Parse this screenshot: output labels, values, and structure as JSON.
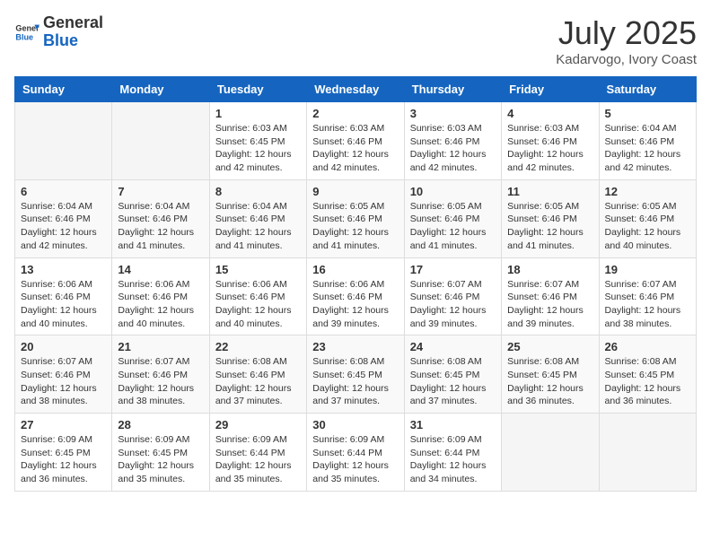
{
  "header": {
    "logo_general": "General",
    "logo_blue": "Blue",
    "month_title": "July 2025",
    "location": "Kadarvogo, Ivory Coast"
  },
  "days_of_week": [
    "Sunday",
    "Monday",
    "Tuesday",
    "Wednesday",
    "Thursday",
    "Friday",
    "Saturday"
  ],
  "weeks": [
    [
      {
        "day": "",
        "info": ""
      },
      {
        "day": "",
        "info": ""
      },
      {
        "day": "1",
        "info": "Sunrise: 6:03 AM\nSunset: 6:45 PM\nDaylight: 12 hours and 42 minutes."
      },
      {
        "day": "2",
        "info": "Sunrise: 6:03 AM\nSunset: 6:46 PM\nDaylight: 12 hours and 42 minutes."
      },
      {
        "day": "3",
        "info": "Sunrise: 6:03 AM\nSunset: 6:46 PM\nDaylight: 12 hours and 42 minutes."
      },
      {
        "day": "4",
        "info": "Sunrise: 6:03 AM\nSunset: 6:46 PM\nDaylight: 12 hours and 42 minutes."
      },
      {
        "day": "5",
        "info": "Sunrise: 6:04 AM\nSunset: 6:46 PM\nDaylight: 12 hours and 42 minutes."
      }
    ],
    [
      {
        "day": "6",
        "info": "Sunrise: 6:04 AM\nSunset: 6:46 PM\nDaylight: 12 hours and 42 minutes."
      },
      {
        "day": "7",
        "info": "Sunrise: 6:04 AM\nSunset: 6:46 PM\nDaylight: 12 hours and 41 minutes."
      },
      {
        "day": "8",
        "info": "Sunrise: 6:04 AM\nSunset: 6:46 PM\nDaylight: 12 hours and 41 minutes."
      },
      {
        "day": "9",
        "info": "Sunrise: 6:05 AM\nSunset: 6:46 PM\nDaylight: 12 hours and 41 minutes."
      },
      {
        "day": "10",
        "info": "Sunrise: 6:05 AM\nSunset: 6:46 PM\nDaylight: 12 hours and 41 minutes."
      },
      {
        "day": "11",
        "info": "Sunrise: 6:05 AM\nSunset: 6:46 PM\nDaylight: 12 hours and 41 minutes."
      },
      {
        "day": "12",
        "info": "Sunrise: 6:05 AM\nSunset: 6:46 PM\nDaylight: 12 hours and 40 minutes."
      }
    ],
    [
      {
        "day": "13",
        "info": "Sunrise: 6:06 AM\nSunset: 6:46 PM\nDaylight: 12 hours and 40 minutes."
      },
      {
        "day": "14",
        "info": "Sunrise: 6:06 AM\nSunset: 6:46 PM\nDaylight: 12 hours and 40 minutes."
      },
      {
        "day": "15",
        "info": "Sunrise: 6:06 AM\nSunset: 6:46 PM\nDaylight: 12 hours and 40 minutes."
      },
      {
        "day": "16",
        "info": "Sunrise: 6:06 AM\nSunset: 6:46 PM\nDaylight: 12 hours and 39 minutes."
      },
      {
        "day": "17",
        "info": "Sunrise: 6:07 AM\nSunset: 6:46 PM\nDaylight: 12 hours and 39 minutes."
      },
      {
        "day": "18",
        "info": "Sunrise: 6:07 AM\nSunset: 6:46 PM\nDaylight: 12 hours and 39 minutes."
      },
      {
        "day": "19",
        "info": "Sunrise: 6:07 AM\nSunset: 6:46 PM\nDaylight: 12 hours and 38 minutes."
      }
    ],
    [
      {
        "day": "20",
        "info": "Sunrise: 6:07 AM\nSunset: 6:46 PM\nDaylight: 12 hours and 38 minutes."
      },
      {
        "day": "21",
        "info": "Sunrise: 6:07 AM\nSunset: 6:46 PM\nDaylight: 12 hours and 38 minutes."
      },
      {
        "day": "22",
        "info": "Sunrise: 6:08 AM\nSunset: 6:46 PM\nDaylight: 12 hours and 37 minutes."
      },
      {
        "day": "23",
        "info": "Sunrise: 6:08 AM\nSunset: 6:45 PM\nDaylight: 12 hours and 37 minutes."
      },
      {
        "day": "24",
        "info": "Sunrise: 6:08 AM\nSunset: 6:45 PM\nDaylight: 12 hours and 37 minutes."
      },
      {
        "day": "25",
        "info": "Sunrise: 6:08 AM\nSunset: 6:45 PM\nDaylight: 12 hours and 36 minutes."
      },
      {
        "day": "26",
        "info": "Sunrise: 6:08 AM\nSunset: 6:45 PM\nDaylight: 12 hours and 36 minutes."
      }
    ],
    [
      {
        "day": "27",
        "info": "Sunrise: 6:09 AM\nSunset: 6:45 PM\nDaylight: 12 hours and 36 minutes."
      },
      {
        "day": "28",
        "info": "Sunrise: 6:09 AM\nSunset: 6:45 PM\nDaylight: 12 hours and 35 minutes."
      },
      {
        "day": "29",
        "info": "Sunrise: 6:09 AM\nSunset: 6:44 PM\nDaylight: 12 hours and 35 minutes."
      },
      {
        "day": "30",
        "info": "Sunrise: 6:09 AM\nSunset: 6:44 PM\nDaylight: 12 hours and 35 minutes."
      },
      {
        "day": "31",
        "info": "Sunrise: 6:09 AM\nSunset: 6:44 PM\nDaylight: 12 hours and 34 minutes."
      },
      {
        "day": "",
        "info": ""
      },
      {
        "day": "",
        "info": ""
      }
    ]
  ]
}
